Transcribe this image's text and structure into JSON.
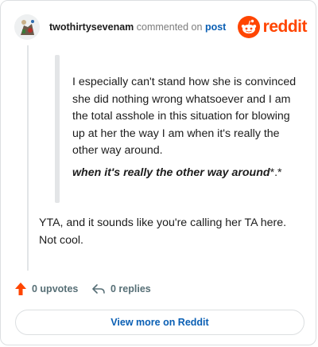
{
  "header": {
    "username": "twothirtysevenam",
    "action_text": "commented on",
    "post_link": "post",
    "brand": "reddit"
  },
  "comment": {
    "quote_paragraph": "I especially can't stand how she is convinced she did nothing wrong whatsoever and I am the total asshole in this situation for blowing up at her the way I am when it's really the other way around.",
    "quote_emphasis": "when it's really the other way around",
    "quote_emphasis_suffix": "*.*",
    "reply": "YTA, and it sounds like you're calling her TA here. Not cool."
  },
  "actions": {
    "upvotes_label": "0 upvotes",
    "replies_label": "0 replies"
  },
  "footer": {
    "view_more_label": "View more on Reddit"
  },
  "colors": {
    "brand": "#ff4500",
    "link": "#0a5fb4",
    "upvote_arrow": "#ff4500"
  },
  "icons": {
    "avatar": "user-avatar-icon",
    "brand": "reddit-logo-icon",
    "upvote": "upvote-arrow-icon",
    "reply": "reply-arrow-icon"
  }
}
